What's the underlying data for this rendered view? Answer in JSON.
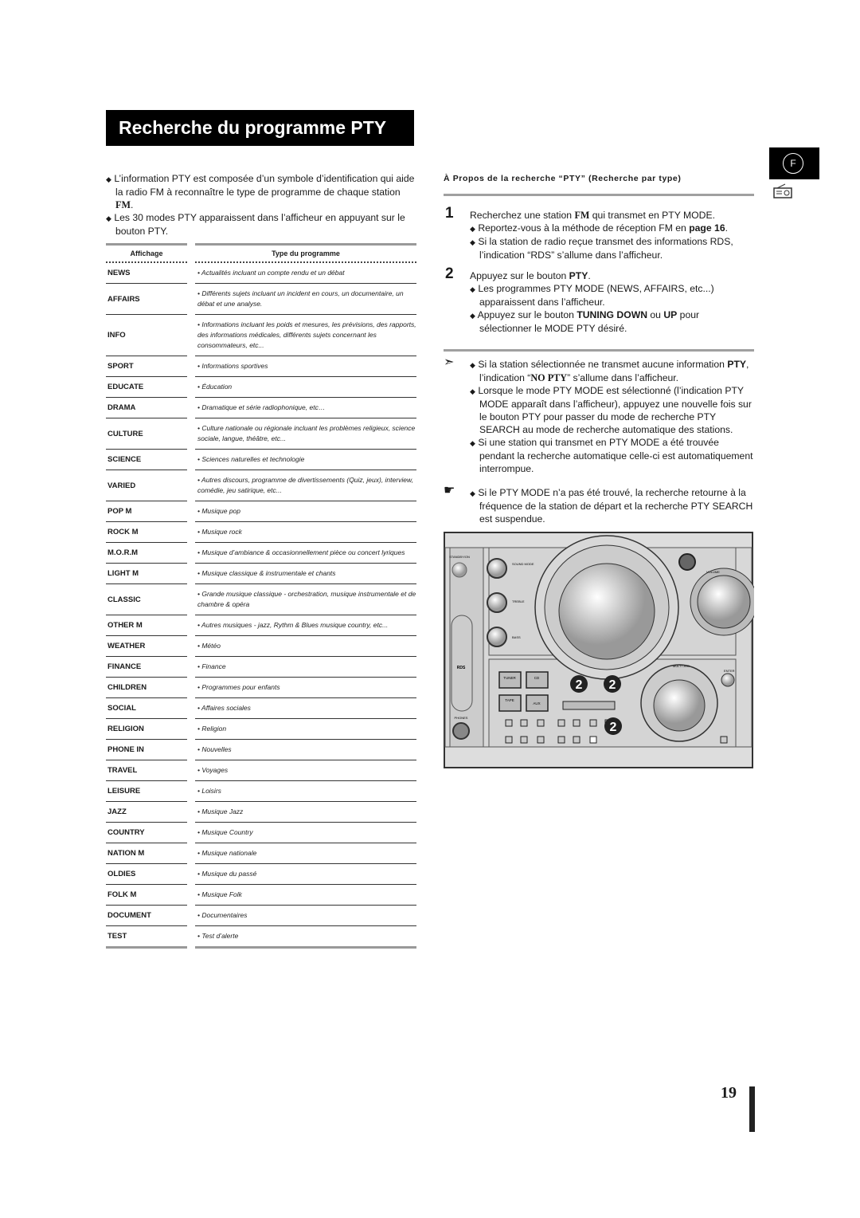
{
  "title": "Recherche du programme PTY",
  "language_tab": "F",
  "icons": {
    "bullet": "diamond-bullet",
    "note": "arrow-note-icon",
    "tip": "pointing-hand-icon",
    "tab": "radio-icon"
  },
  "intro": [
    {
      "text_before": "L’information PTY est composée d’un symbole d’identification qui aide la radio FM à reconnaître le type de programme de chaque station ",
      "bold": "FM",
      "text_after": "."
    },
    {
      "text_before": "Les 30 modes PTY apparaissent dans l’afficheur en appuyant sur le bouton PTY.",
      "bold": "",
      "text_after": ""
    }
  ],
  "table": {
    "headers": [
      "Affichage",
      "Type du programme"
    ],
    "rows": [
      [
        "NEWS",
        "• Actualités incluant un compte rendu et un débat"
      ],
      [
        "AFFAIRS",
        "• Différents sujets incluant un incident en cours, un documentaire, un débat et une analyse."
      ],
      [
        "INFO",
        "•  Informations incluant les poids et mesures, les prévisions, des rapports, des informations médicales, différents sujets concernant les consommateurs, etc..."
      ],
      [
        "SPORT",
        "• Informations sportives"
      ],
      [
        "EDUCATE",
        "• Éducation"
      ],
      [
        "DRAMA",
        "• Dramatique et série radiophonique, etc…"
      ],
      [
        "CULTURE",
        "• Culture nationale ou régionale incluant les problèmes religieux, science sociale, langue, théâtre, etc..."
      ],
      [
        "SCIENCE",
        "• Sciences naturelles et technologie"
      ],
      [
        "VARIED",
        "• Autres discours, programme de divertissements (Quiz, jeux), interview, comédie, jeu satirique, etc..."
      ],
      [
        "POP M",
        "• Musique pop"
      ],
      [
        "ROCK M",
        "• Musique rock"
      ],
      [
        "M.O.R.M",
        "• Musique d’ambiance & occasionnellement pièce ou concert lyriques"
      ],
      [
        "LIGHT M",
        "• Musique classique & instrumentale et chants"
      ],
      [
        "CLASSIC",
        "• Grande musique classique - orchestration, musique instrumentale et de chambre & opéra"
      ],
      [
        "OTHER M",
        "• Autres musiques - jazz, Rythm & Blues musique country, etc..."
      ],
      [
        "WEATHER",
        "• Météo"
      ],
      [
        "FINANCE",
        "• Finance"
      ],
      [
        "CHILDREN",
        "• Programmes pour enfants"
      ],
      [
        "SOCIAL",
        "• Affaires sociales"
      ],
      [
        "RELIGION",
        "• Religion"
      ],
      [
        "PHONE IN",
        "• Nouvelles"
      ],
      [
        "TRAVEL",
        "• Voyages"
      ],
      [
        "LEISURE",
        "• Loisirs"
      ],
      [
        "JAZZ",
        "• Musique Jazz"
      ],
      [
        "COUNTRY",
        "• Musique Country"
      ],
      [
        "NATION M",
        "• Musique nationale"
      ],
      [
        "OLDIES",
        "• Musique du passé"
      ],
      [
        "FOLK M",
        "• Musique Folk"
      ],
      [
        "DOCUMENT",
        "• Documentaires"
      ],
      [
        "TEST",
        "• Test d’alerte"
      ]
    ]
  },
  "right": {
    "heading": "À Propos de la recherche “PTY” (Recherche par type)",
    "step1": {
      "num": "1",
      "a": "Recherchez une station ",
      "b": "FM",
      "c": " qui transmet en PTY MODE.",
      "sub1a": "Reportez-vous à la méthode de réception FM en ",
      "sub1b": "page 16",
      "sub1c": ".",
      "sub2": "Si la station de radio reçue transmet des informations RDS, l’indication “RDS” s’allume dans l’afficheur."
    },
    "step2": {
      "num": "2",
      "a": "Appuyez sur le bouton ",
      "b": "PTY",
      "c": ".",
      "sub1": "Les programmes PTY MODE (NEWS, AFFAIRS, etc...) apparaissent dans l’afficheur.",
      "sub2a": "Appuyez sur le bouton ",
      "sub2b": "TUNING DOWN",
      "sub2c": " ou ",
      "sub2d": "UP",
      "sub2e": " pour sélectionner le MODE PTY désiré."
    },
    "notes": {
      "n1a": "Si la station sélectionnée ne transmet aucune information ",
      "n1b": "PTY",
      "n1c": ", l’indication “",
      "n1d": "NO PTY",
      "n1e": "” s’allume dans l’afficheur.",
      "n2": "Lorsque le mode PTY MODE est sélectionné (l’indication PTY MODE apparaît dans l’afficheur), appuyez une nouvelle fois sur le bouton PTY pour passer  du mode de recherche PTY SEARCH au mode de recherche automatique des stations.",
      "n3": "Si une station qui transmet en PTY MODE a été trouvée pendant la recherche automatique celle-ci est automatiquement interrompue.",
      "tip": "Si le PTY MODE n’a pas été trouvé, la recherche retourne à la fréquence de la station de départ et la recherche PTY SEARCH est suspendue."
    }
  },
  "device": {
    "labels": {
      "sound": "SOUND MODE",
      "treble": "TREBLE",
      "bass": "BASS",
      "tuner": "TUNER",
      "cd": "CD",
      "tape": "TAPE",
      "aux": "AUX",
      "multi_jog": "MULTI JOG",
      "enter": "ENTER",
      "volume": "VOLUME",
      "phones": "PHONES",
      "rds": "RDS",
      "standby": "STANDBY/ON"
    },
    "callout": "2"
  },
  "page_number": "19"
}
